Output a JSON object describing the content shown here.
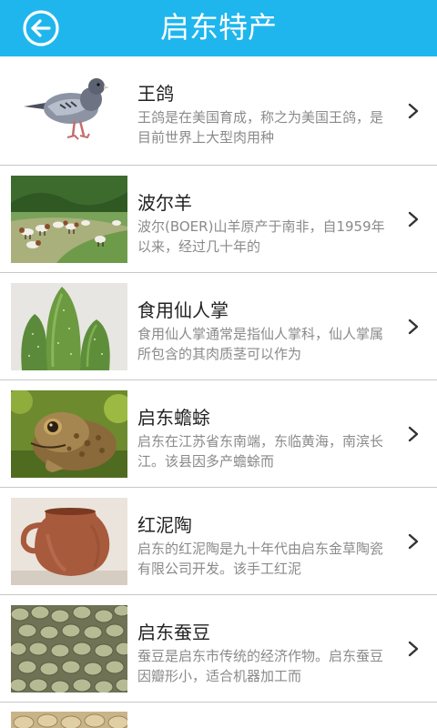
{
  "header": {
    "title": "启东特产",
    "back_icon": "back-arrow-icon",
    "background": "#1fb6ee"
  },
  "items": [
    {
      "title": "王鸽",
      "desc": "王鸽是在美国育成，称之为美国王鸽，是目前世界上大型肉用种",
      "image": "pigeon"
    },
    {
      "title": "波尔羊",
      "desc": "波尔(BOER)山羊原产于南非，自1959年以来，经过几十年的",
      "image": "goats"
    },
    {
      "title": "食用仙人掌",
      "desc": "食用仙人掌通常是指仙人掌科，仙人掌属所包含的其肉质茎可以作为",
      "image": "cactus"
    },
    {
      "title": "启东蟾蜍",
      "desc": "启东在江苏省东南端，东临黄海，南滨长江。该县因多产蟾蜍而",
      "image": "toad"
    },
    {
      "title": "红泥陶",
      "desc": "启东的红泥陶是九十年代由启东金草陶瓷有限公司开发。该手工红泥",
      "image": "clay-pot"
    },
    {
      "title": "启东蚕豆",
      "desc": "蚕豆是启东市传统的经济作物。启东蚕豆因瓣形小，适合机器加工而",
      "image": "broad-beans"
    }
  ],
  "chevron_icon": "chevron-right-icon"
}
